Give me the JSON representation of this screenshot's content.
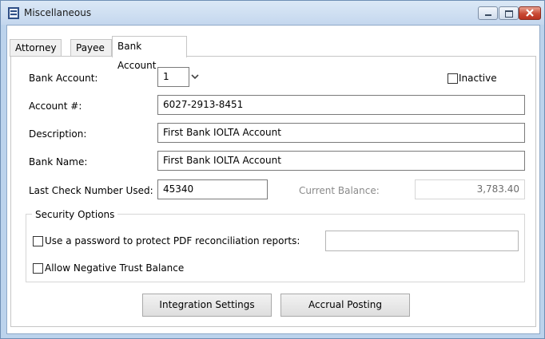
{
  "window": {
    "title": "Miscellaneous"
  },
  "tabs": [
    {
      "label": "Attorney"
    },
    {
      "label": "Payee"
    },
    {
      "label": "Bank Account"
    }
  ],
  "form": {
    "bank_account": {
      "label": "Bank Account:",
      "value": "1"
    },
    "inactive": {
      "label": "Inactive",
      "checked": false
    },
    "account_number": {
      "label": "Account #:",
      "value": "6027-2913-8451"
    },
    "description": {
      "label": "Description:",
      "value": "First Bank IOLTA Account"
    },
    "bank_name": {
      "label": "Bank Name:",
      "value": "First Bank IOLTA Account"
    },
    "last_check": {
      "label": "Last Check Number Used:",
      "value": "45340"
    },
    "current_balance": {
      "label": "Current Balance:",
      "value": "3,783.40"
    }
  },
  "security": {
    "title": "Security Options",
    "password_option": {
      "label": "Use a password to protect PDF reconciliation reports:",
      "checked": false,
      "value": ""
    },
    "negative_balance": {
      "label": "Allow Negative Trust Balance",
      "checked": false
    }
  },
  "buttons": {
    "integration": "Integration Settings",
    "accrual": "Accrual Posting"
  },
  "colors": {
    "titlebar": "#c4d7ee",
    "close_button": "#c94a35",
    "frame": "#bcd3ec"
  }
}
